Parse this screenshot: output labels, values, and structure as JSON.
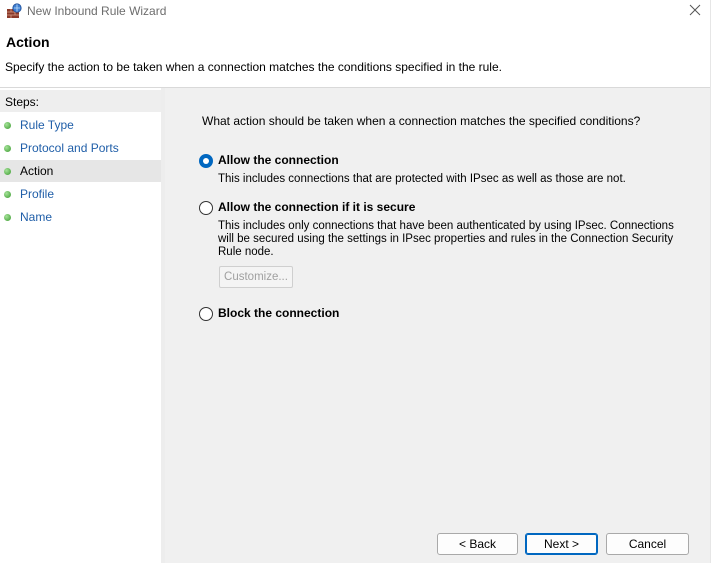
{
  "window": {
    "title": "New Inbound Rule Wizard",
    "icons": {
      "app": "firewall-icon",
      "close": "close-icon"
    }
  },
  "header": {
    "title": "Action",
    "description": "Specify the action to be taken when a connection matches the conditions specified in the rule."
  },
  "steps": {
    "heading": "Steps:",
    "items": [
      {
        "label": "Rule Type",
        "active": false
      },
      {
        "label": "Protocol and Ports",
        "active": false
      },
      {
        "label": "Action",
        "active": true
      },
      {
        "label": "Profile",
        "active": false
      },
      {
        "label": "Name",
        "active": false
      }
    ],
    "colors": {
      "link": "#1f5ea8",
      "dot": "#3a9a2e"
    }
  },
  "main": {
    "question": "What action should be taken when a connection matches the specified conditions?",
    "options": [
      {
        "label": "Allow the connection",
        "checked": true,
        "description": "This includes connections that are protected with IPsec as well as those are not."
      },
      {
        "label": "Allow the connection if it is secure",
        "checked": false,
        "description_lines": [
          "This includes only connections that have been authenticated by using IPsec.  Connections",
          "will be secured using the settings in IPsec properties and rules in the Connection Security",
          "Rule node."
        ],
        "customize_label": "Customize...",
        "customize_enabled": false
      },
      {
        "label": "Block the connection",
        "checked": false
      }
    ]
  },
  "footer": {
    "back_label": "< Back",
    "next_label": "Next >",
    "cancel_label": "Cancel"
  },
  "colors": {
    "accent": "#0067c0",
    "content_bg": "#f0f0f0"
  }
}
